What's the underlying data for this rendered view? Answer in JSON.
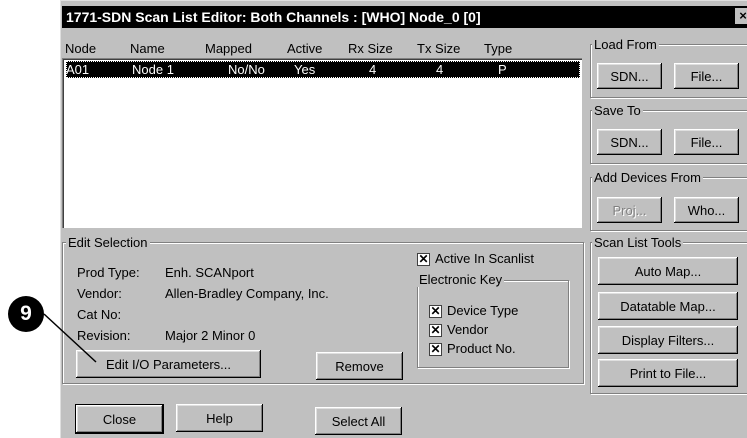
{
  "window": {
    "title": "1771-SDN Scan List Editor: Both Channels : [WHO] Node_0 [0]",
    "close_glyph": "×"
  },
  "list": {
    "columns": [
      "Node",
      "Name",
      "Mapped",
      "Active",
      "Rx Size",
      "Tx Size",
      "Type"
    ],
    "rows": [
      {
        "node": "A01",
        "name": "Node 1",
        "mapped": "No/No",
        "active": "Yes",
        "rx": "4",
        "tx": "4",
        "type": "P"
      }
    ]
  },
  "load_from": {
    "label": "Load From",
    "sdn": "SDN...",
    "file": "File..."
  },
  "save_to": {
    "label": "Save To",
    "sdn": "SDN...",
    "file": "File..."
  },
  "add_devices": {
    "label": "Add Devices From",
    "proj": "Proj...",
    "who": "Who..."
  },
  "tools": {
    "label": "Scan List Tools",
    "auto_map": "Auto Map...",
    "datatable_map": "Datatable Map...",
    "display_filters": "Display Filters...",
    "print_to_file": "Print to File..."
  },
  "edit_selection": {
    "label": "Edit Selection",
    "prod_type_label": "Prod Type:",
    "prod_type": "Enh. SCANport",
    "vendor_label": "Vendor:",
    "vendor": "Allen-Bradley Company, Inc.",
    "cat_no_label": "Cat No:",
    "cat_no": "",
    "revision_label": "Revision:",
    "revision": "Major 2 Minor 0",
    "active_in_scanlist": "Active In Scanlist",
    "electronic_key_label": "Electronic Key",
    "device_type": "Device Type",
    "vendor_chk": "Vendor",
    "product_no": "Product No.",
    "edit_io": "Edit I/O Parameters...",
    "remove": "Remove"
  },
  "footer": {
    "close": "Close",
    "help": "Help",
    "select_all": "Select All"
  },
  "callout": {
    "number": "9"
  }
}
